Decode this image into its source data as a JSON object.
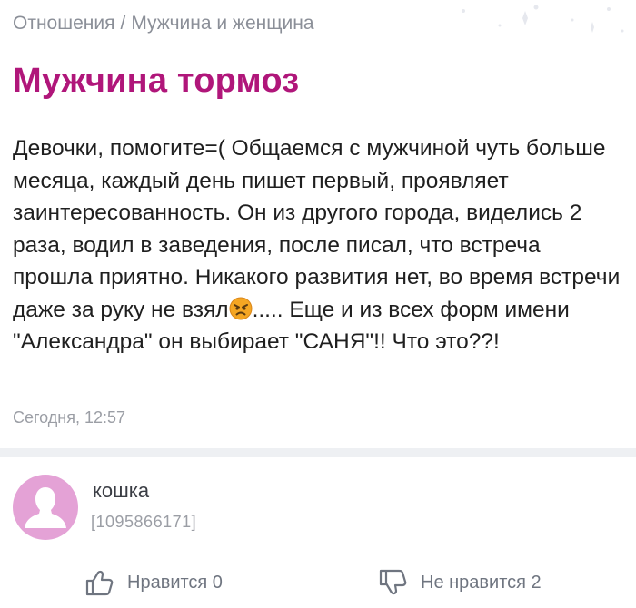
{
  "breadcrumb": {
    "category": "Отношения",
    "separator": "/",
    "subcategory": "Мужчина и женщина"
  },
  "post": {
    "title": "Мужчина тормоз",
    "text_part1": "Девочки, помогите=( Общаемся с мужчиной чуть больше месяца, каждый день пишет первый, проявляет заинтересованность. Он из другого города, виделись 2 раза, водил в заведения, после писал, что встреча прошла приятно. Никакого развития нет, во время встречи даже за руку не взял",
    "emoji_icon": "angry-face-icon",
    "text_part2": "..... Еще и из всех форм имени \"Александра\" он выбирает \"САНЯ\"!! Что это??!",
    "timestamp": "Сегодня, 12:57"
  },
  "author": {
    "name": "кошка",
    "id": "[1095866171]",
    "avatar_icon": "user-silhouette-icon"
  },
  "reactions": {
    "like_label": "Нравится 0",
    "dislike_label": "Не нравится 2",
    "like_icon": "thumbs-up-icon",
    "dislike_icon": "thumbs-down-icon"
  },
  "colors": {
    "title": "#b0167a",
    "avatar_bg": "#e4a2d6",
    "muted_text": "#8b8f98"
  }
}
